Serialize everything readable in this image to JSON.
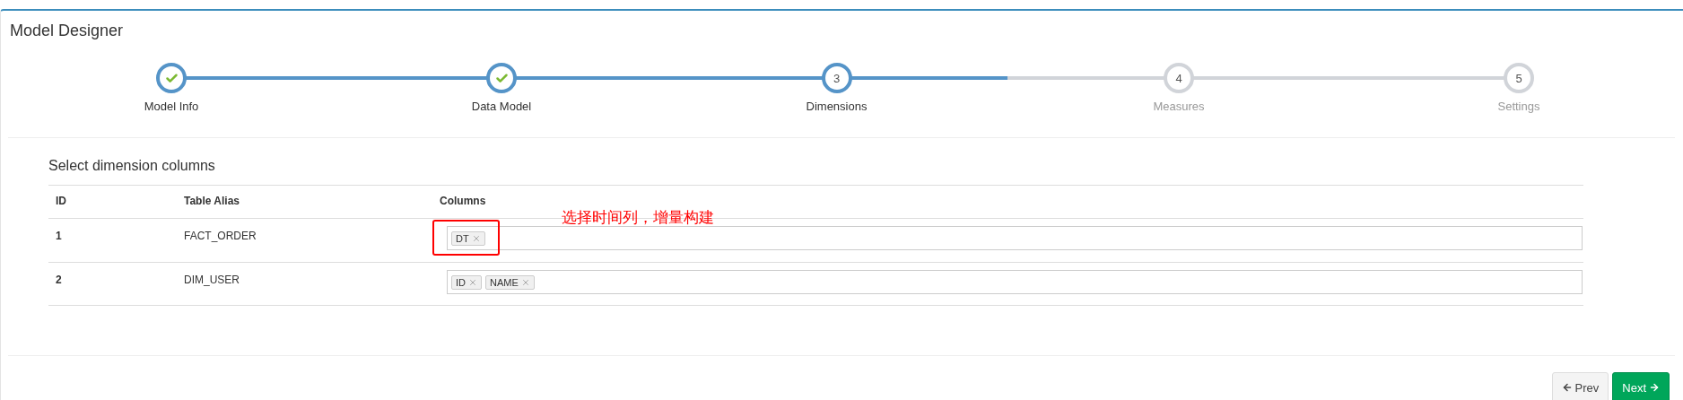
{
  "panel": {
    "title": "Model Designer"
  },
  "steps": [
    {
      "label": "Model Info",
      "completed": true,
      "active": false
    },
    {
      "label": "Data Model",
      "completed": true,
      "active": false
    },
    {
      "label": "Dimensions",
      "completed": false,
      "active": true,
      "number": "3"
    },
    {
      "label": "Measures",
      "completed": false,
      "active": false,
      "number": "4"
    },
    {
      "label": "Settings",
      "completed": false,
      "active": false,
      "number": "5"
    }
  ],
  "section": {
    "title": "Select dimension columns"
  },
  "table": {
    "columns": [
      "ID",
      "Table Alias",
      "Columns"
    ],
    "rows": [
      {
        "id": "1",
        "alias": "FACT_ORDER",
        "tags": [
          "DT"
        ],
        "annotated": true
      },
      {
        "id": "2",
        "alias": "DIM_USER",
        "tags": [
          "ID",
          "NAME"
        ],
        "annotated": false
      }
    ]
  },
  "annotation": {
    "text": "选择时间列，增量构建"
  },
  "buttons": [
    {
      "label": "Prev",
      "kind": "prev"
    },
    {
      "label": "Next",
      "kind": "next"
    }
  ]
}
